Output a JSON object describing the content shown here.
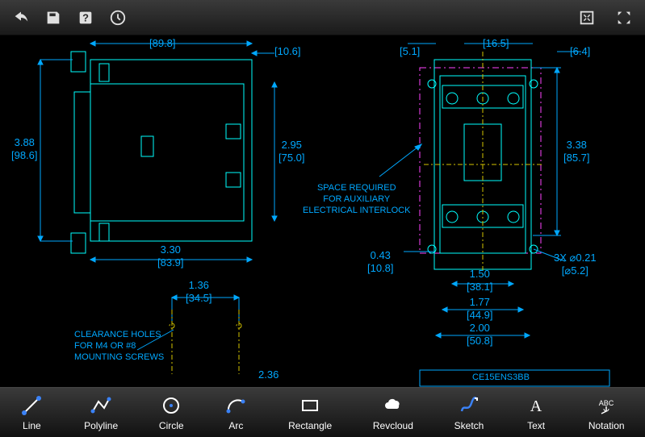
{
  "topToolbar": {
    "icons": [
      "undo",
      "save",
      "help",
      "clock"
    ],
    "rightIcons": [
      "fit-screen",
      "fullscreen"
    ]
  },
  "tools": [
    {
      "id": "line",
      "label": "Line"
    },
    {
      "id": "polyline",
      "label": "Polyline"
    },
    {
      "id": "circle",
      "label": "Circle"
    },
    {
      "id": "arc",
      "label": "Arc"
    },
    {
      "id": "rectangle",
      "label": "Rectangle"
    },
    {
      "id": "revcloud",
      "label": "Revcloud"
    },
    {
      "id": "sketch",
      "label": "Sketch"
    },
    {
      "id": "text",
      "label": "Text"
    },
    {
      "id": "notation",
      "label": "Notation"
    }
  ],
  "dimensions": {
    "topA": "[89.8]",
    "topB": "[10.6]",
    "height388": "3.88\n[98.6]",
    "height295": "2.95\n[75.0]",
    "width330": "3.30\n[83.9]",
    "dim136": "1.36\n[34.5]",
    "dim236": "2.36",
    "topC": "[5.1]",
    "topD": "[16.5]",
    "topE": "[6.4]",
    "height338": "3.38\n[85.7]",
    "dim043": "0.43\n[10.8]",
    "dim150": "1.50\n[38.1]",
    "dim177": "1.77\n[44.9]",
    "dim200": "2.00\n[50.8]",
    "dim3x": "3X ⌀0.21\n[⌀5.2]"
  },
  "notes": {
    "spaceReq": "SPACE REQUIRED\nFOR AUXILIARY\nELECTRICAL INTERLOCK",
    "clearance": "CLEARANCE HOLES\nFOR M4 OR #8\nMOUNTING SCREWS",
    "partNo": "CE15ENS3BB"
  }
}
